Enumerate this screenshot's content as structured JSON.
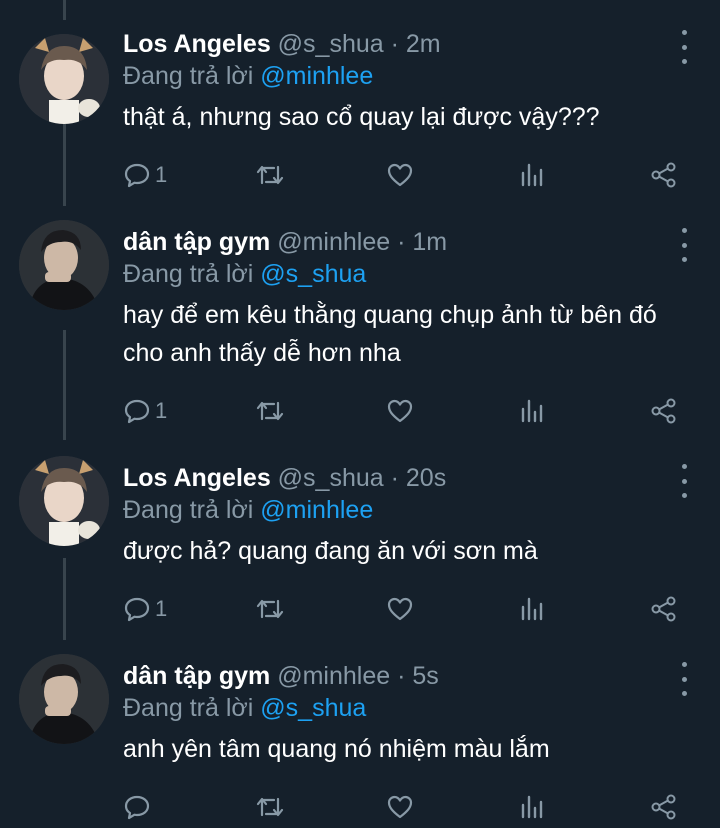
{
  "colors": {
    "background": "#15202b",
    "muted": "#8899a6",
    "mention": "#1da1f2",
    "thread_line": "#38444d"
  },
  "tweets": [
    {
      "name": "Los Angeles",
      "handle": "@s_shua",
      "separator": "·",
      "time": "2m",
      "reply_prefix": "Đang trả lời",
      "reply_to": "@minhlee",
      "text": "thật á, nhưng sao cổ quay lại được vậy???",
      "reply_count": "1"
    },
    {
      "name": "dân tập gym",
      "handle": "@minhlee",
      "separator": "·",
      "time": "1m",
      "reply_prefix": "Đang trả lời",
      "reply_to": "@s_shua",
      "text": "hay để em kêu thằng quang chụp ảnh từ bên đó cho anh thấy dễ hơn nha",
      "reply_count": "1"
    },
    {
      "name": "Los Angeles",
      "handle": "@s_shua",
      "separator": "·",
      "time": "20s",
      "reply_prefix": "Đang trả lời",
      "reply_to": "@minhlee",
      "text": "được hả? quang đang ăn với sơn mà",
      "reply_count": "1"
    },
    {
      "name": "dân tập gym",
      "handle": "@minhlee",
      "separator": "·",
      "time": "5s",
      "reply_prefix": "Đang trả lời",
      "reply_to": "@s_shua",
      "text": "anh yên tâm quang nó nhiệm màu lắm",
      "reply_count": ""
    }
  ],
  "icons": {
    "reply": "speech-bubble-icon",
    "retweet": "retweet-icon",
    "like": "heart-icon",
    "analytics": "analytics-bars-icon",
    "share": "share-icon",
    "more": "more-vertical-icon"
  }
}
